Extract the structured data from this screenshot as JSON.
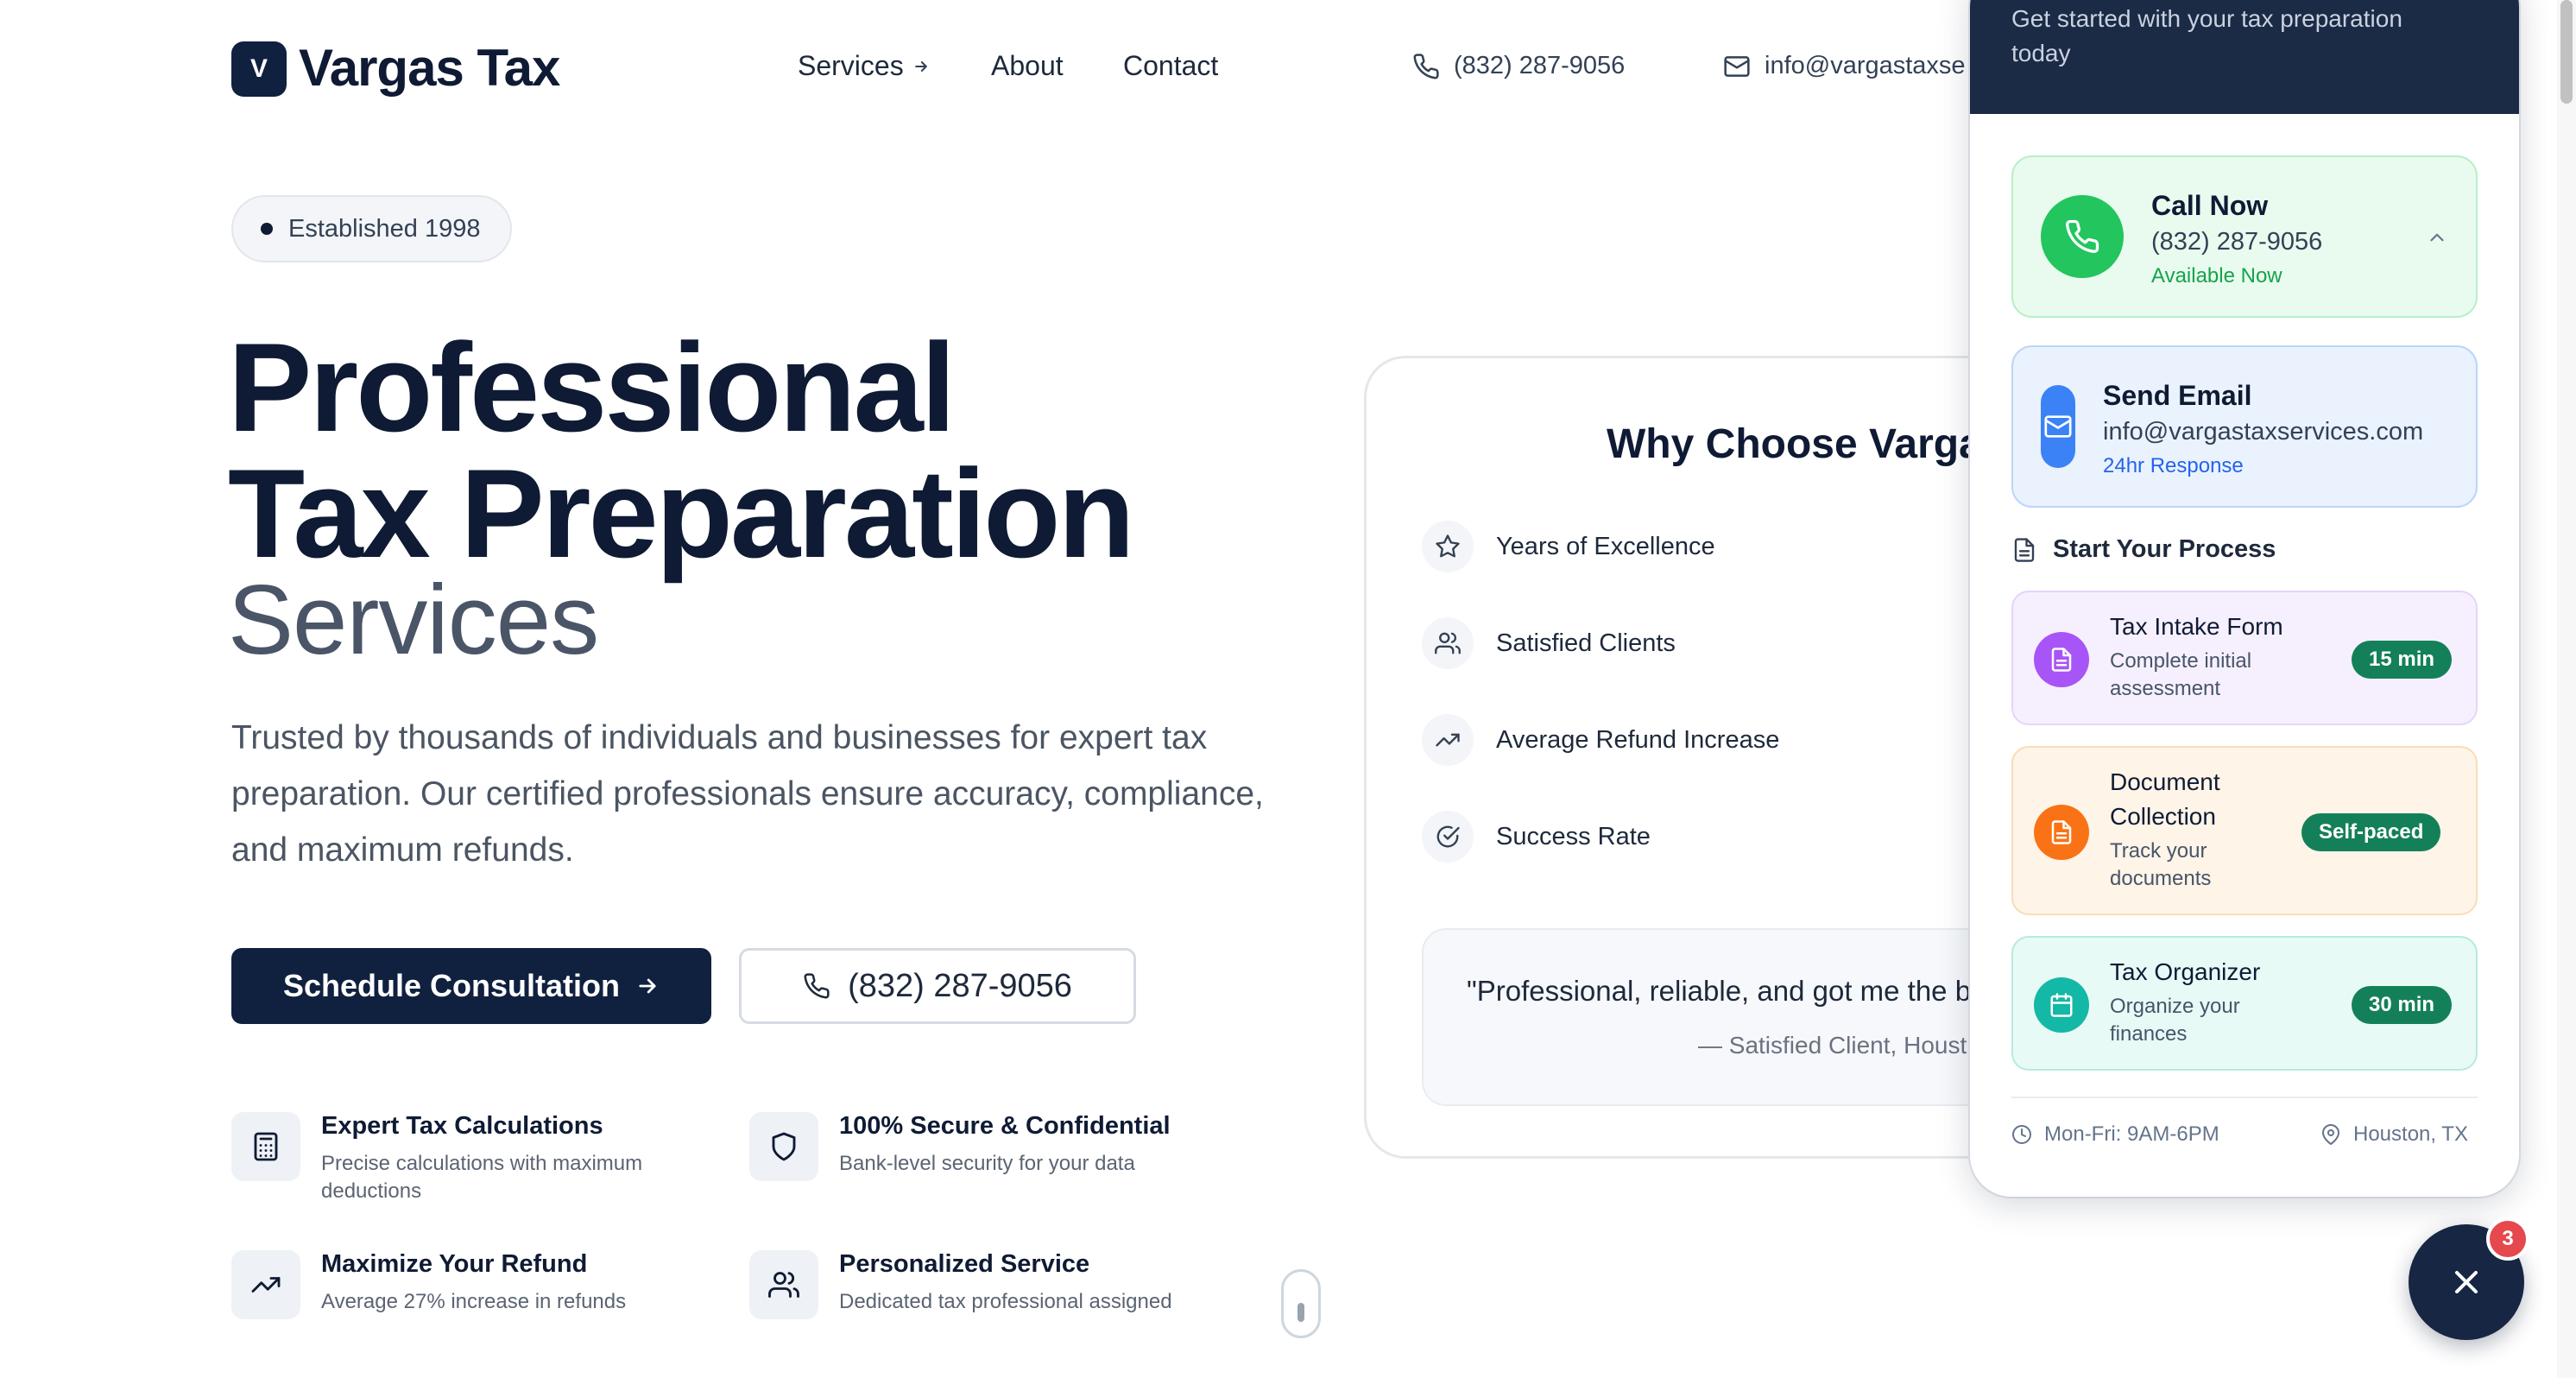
{
  "header": {
    "logo_letter": "V",
    "brand": "Vargas Tax",
    "nav": {
      "services": "Services",
      "about": "About",
      "contact": "Contact"
    },
    "phone": "(832) 287-9056",
    "email": "info@vargastaxse"
  },
  "hero": {
    "badge": "Established 1998",
    "title_line1": "Professional",
    "title_line2": "Tax Preparation",
    "title_line3": "Services",
    "lead": "Trusted by thousands of individuals and businesses for expert tax preparation. Our certified professionals ensure accuracy, compliance, and maximum refunds.",
    "cta_primary": "Schedule Consultation",
    "cta_phone": "(832) 287-9056",
    "features": [
      {
        "title": "Expert Tax Calculations",
        "desc": "Precise calculations with maximum deductions",
        "icon": "calculator-icon"
      },
      {
        "title": "100% Secure & Confidential",
        "desc": "Bank-level security for your data",
        "icon": "shield-icon"
      },
      {
        "title": "Maximize Your Refund",
        "desc": "Average 27% increase in refunds",
        "icon": "trending-up-icon"
      },
      {
        "title": "Personalized Service",
        "desc": "Dedicated tax professional assigned",
        "icon": "users-icon"
      }
    ]
  },
  "why": {
    "title": "Why Choose Vargas",
    "items": [
      {
        "label": "Years of Excellence",
        "icon": "star-icon"
      },
      {
        "label": "Satisfied Clients",
        "icon": "users-icon"
      },
      {
        "label": "Average Refund Increase",
        "icon": "trending-up-icon"
      },
      {
        "label": "Success Rate",
        "icon": "check-circle-icon"
      }
    ],
    "quote": "\"Professional, reliable, and got me the b",
    "quote_by": "— Satisfied Client, Houst"
  },
  "panel": {
    "header_text": "Get started with your tax preparation today",
    "call": {
      "title": "Call Now",
      "phone": "(832) 287-9056",
      "status": "Available Now"
    },
    "email": {
      "title": "Send Email",
      "address": "info@vargastaxservices.com",
      "status": "24hr Response"
    },
    "process_heading": "Start Your Process",
    "process": [
      {
        "title": "Tax Intake Form",
        "desc": "Complete initial assessment",
        "badge": "15 min"
      },
      {
        "title": "Document Collection",
        "desc": "Track your documents",
        "badge": "Self-paced"
      },
      {
        "title": "Tax Organizer",
        "desc": "Organize your finances",
        "badge": "30 min"
      }
    ],
    "hours": "Mon-Fri: 9AM-6PM",
    "location": "Houston, TX"
  },
  "fab": {
    "badge_count": "3"
  },
  "colors": {
    "navy": "#10203f",
    "green": "#22c55e",
    "blue": "#3b82f6",
    "purple": "#a855f7",
    "orange": "#f97316",
    "teal": "#14b8a6",
    "badge_green": "#14805a",
    "notification_red": "#e5484d"
  }
}
